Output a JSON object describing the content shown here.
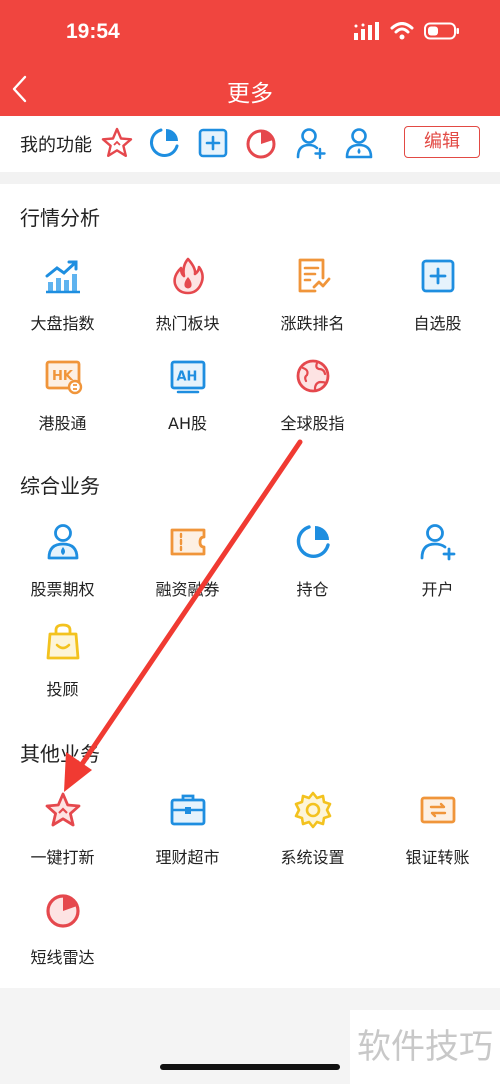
{
  "status": {
    "time": "19:54"
  },
  "nav": {
    "title": "更多"
  },
  "my_functions": {
    "label": "我的功能",
    "icons": [
      "star-icon",
      "position-icon",
      "watchlist-add-icon",
      "radar-icon",
      "add-user-icon",
      "stock-option-icon"
    ],
    "edit_label": "编辑"
  },
  "sections": [
    {
      "title": "行情分析",
      "items": [
        {
          "label": "大盘指数",
          "icon": "chart-trend-icon"
        },
        {
          "label": "热门板块",
          "icon": "flame-icon"
        },
        {
          "label": "涨跌排名",
          "icon": "ranking-doc-icon"
        },
        {
          "label": "自选股",
          "icon": "plus-square-icon"
        },
        {
          "label": "港股通",
          "icon": "hk-icon"
        },
        {
          "label": "AH股",
          "icon": "ah-icon"
        },
        {
          "label": "全球股指",
          "icon": "globe-icon"
        }
      ]
    },
    {
      "title": "综合业务",
      "items": [
        {
          "label": "股票期权",
          "icon": "person-drop-icon"
        },
        {
          "label": "融资融券",
          "icon": "ticket-icon"
        },
        {
          "label": "持仓",
          "icon": "pie-ring-icon"
        },
        {
          "label": "开户",
          "icon": "add-user-icon"
        },
        {
          "label": "投顾",
          "icon": "bag-smile-icon"
        }
      ]
    },
    {
      "title": "其他业务",
      "items": [
        {
          "label": "一键打新",
          "icon": "star-icon"
        },
        {
          "label": "理财超市",
          "icon": "briefcase-icon"
        },
        {
          "label": "系统设置",
          "icon": "gear-icon"
        },
        {
          "label": "银证转账",
          "icon": "transfer-icon"
        },
        {
          "label": "短线雷达",
          "icon": "radar-icon"
        }
      ]
    }
  ],
  "watermark": "软件技巧",
  "colors": {
    "header": "#f0453f",
    "blue": "#1e8ee0",
    "red": "#e5484d",
    "orange": "#f0953a",
    "yellow": "#f3c21e",
    "annotation_arrow": "#f03a32"
  }
}
